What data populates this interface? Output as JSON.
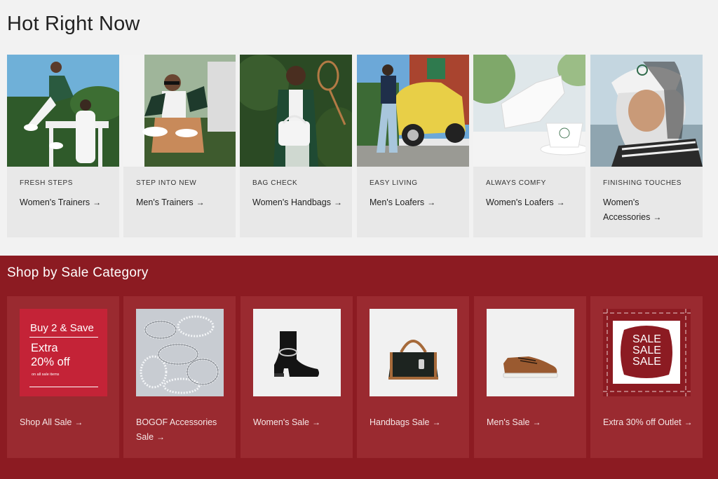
{
  "hot": {
    "title": "Hot Right Now",
    "cards": [
      {
        "eyebrow": "FRESH STEPS",
        "label": "Women's Trainers"
      },
      {
        "eyebrow": "STEP INTO NEW",
        "label": "Men's Trainers"
      },
      {
        "eyebrow": "BAG CHECK",
        "label": "Women's Handbags"
      },
      {
        "eyebrow": "EASY LIVING",
        "label": "Men's Loafers"
      },
      {
        "eyebrow": "ALWAYS COMFY",
        "label": "Women's Loafers"
      },
      {
        "eyebrow": "FINISHING TOUCHES",
        "label": "Women's Accessories"
      }
    ]
  },
  "sale": {
    "title": "Shop by Sale Category",
    "promo": {
      "headline": "Buy 2 & Save",
      "big_line1": "Extra",
      "big_line2": "20% off",
      "small": "on all sale items"
    },
    "sale_tile_words": [
      "SALE",
      "SALE",
      "SALE"
    ],
    "cards": [
      {
        "label": "Shop All Sale"
      },
      {
        "label": "BOGOF Accessories Sale"
      },
      {
        "label": "Women's Sale"
      },
      {
        "label": "Handbags Sale"
      },
      {
        "label": "Men's Sale"
      },
      {
        "label": "Extra 30% off Outlet"
      }
    ]
  },
  "icons": {
    "arrow": "→"
  },
  "colors": {
    "sale_bg": "#8c1b22",
    "promo_red": "#c42337",
    "page_bg": "#f2f2f2"
  }
}
